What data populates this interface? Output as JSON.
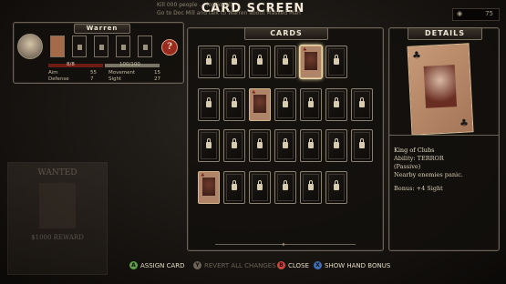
{
  "screen_title": "CARD SCREEN",
  "objectives": [
    "Kill 000 people ... (optional)",
    "Go to Doc Mill and talk to Warren about Masked Man"
  ],
  "money": {
    "value": "75"
  },
  "character": {
    "name": "Warren",
    "health_text": "8/8",
    "xp_text": "100/100",
    "stats": [
      {
        "label": "Aim",
        "value": "55"
      },
      {
        "label": "Movement",
        "value": "15"
      },
      {
        "label": "Defense",
        "value": "7"
      },
      {
        "label": "Sight",
        "value": "27"
      }
    ],
    "help_icon": "?"
  },
  "cards_panel": {
    "title": "CARDS"
  },
  "details_panel": {
    "title": "DETAILS",
    "card_name": "King of Clubs",
    "ability": "Ability: TERROR",
    "passive": "(Passive)",
    "description": "Nearby enemies panic.",
    "bonus": "Bonus: +4 Sight"
  },
  "wanted_poster": {
    "title": "WANTED",
    "reward": "$1000 REWARD"
  },
  "controls": [
    {
      "button": "A",
      "label": "ASSIGN CARD",
      "enabled": true,
      "color": "#5fa04a"
    },
    {
      "button": "Y",
      "label": "REVERT ALL CHANGES",
      "enabled": false,
      "color": "#6b6355"
    },
    {
      "button": "B",
      "label": "CLOSE",
      "enabled": true,
      "color": "#c8493c"
    },
    {
      "button": "X",
      "label": "SHOW HAND BONUS",
      "enabled": true,
      "color": "#3e6fb8"
    }
  ],
  "colors": {
    "accent": "#e8d8a6",
    "help_red": "#9b2a1e"
  }
}
